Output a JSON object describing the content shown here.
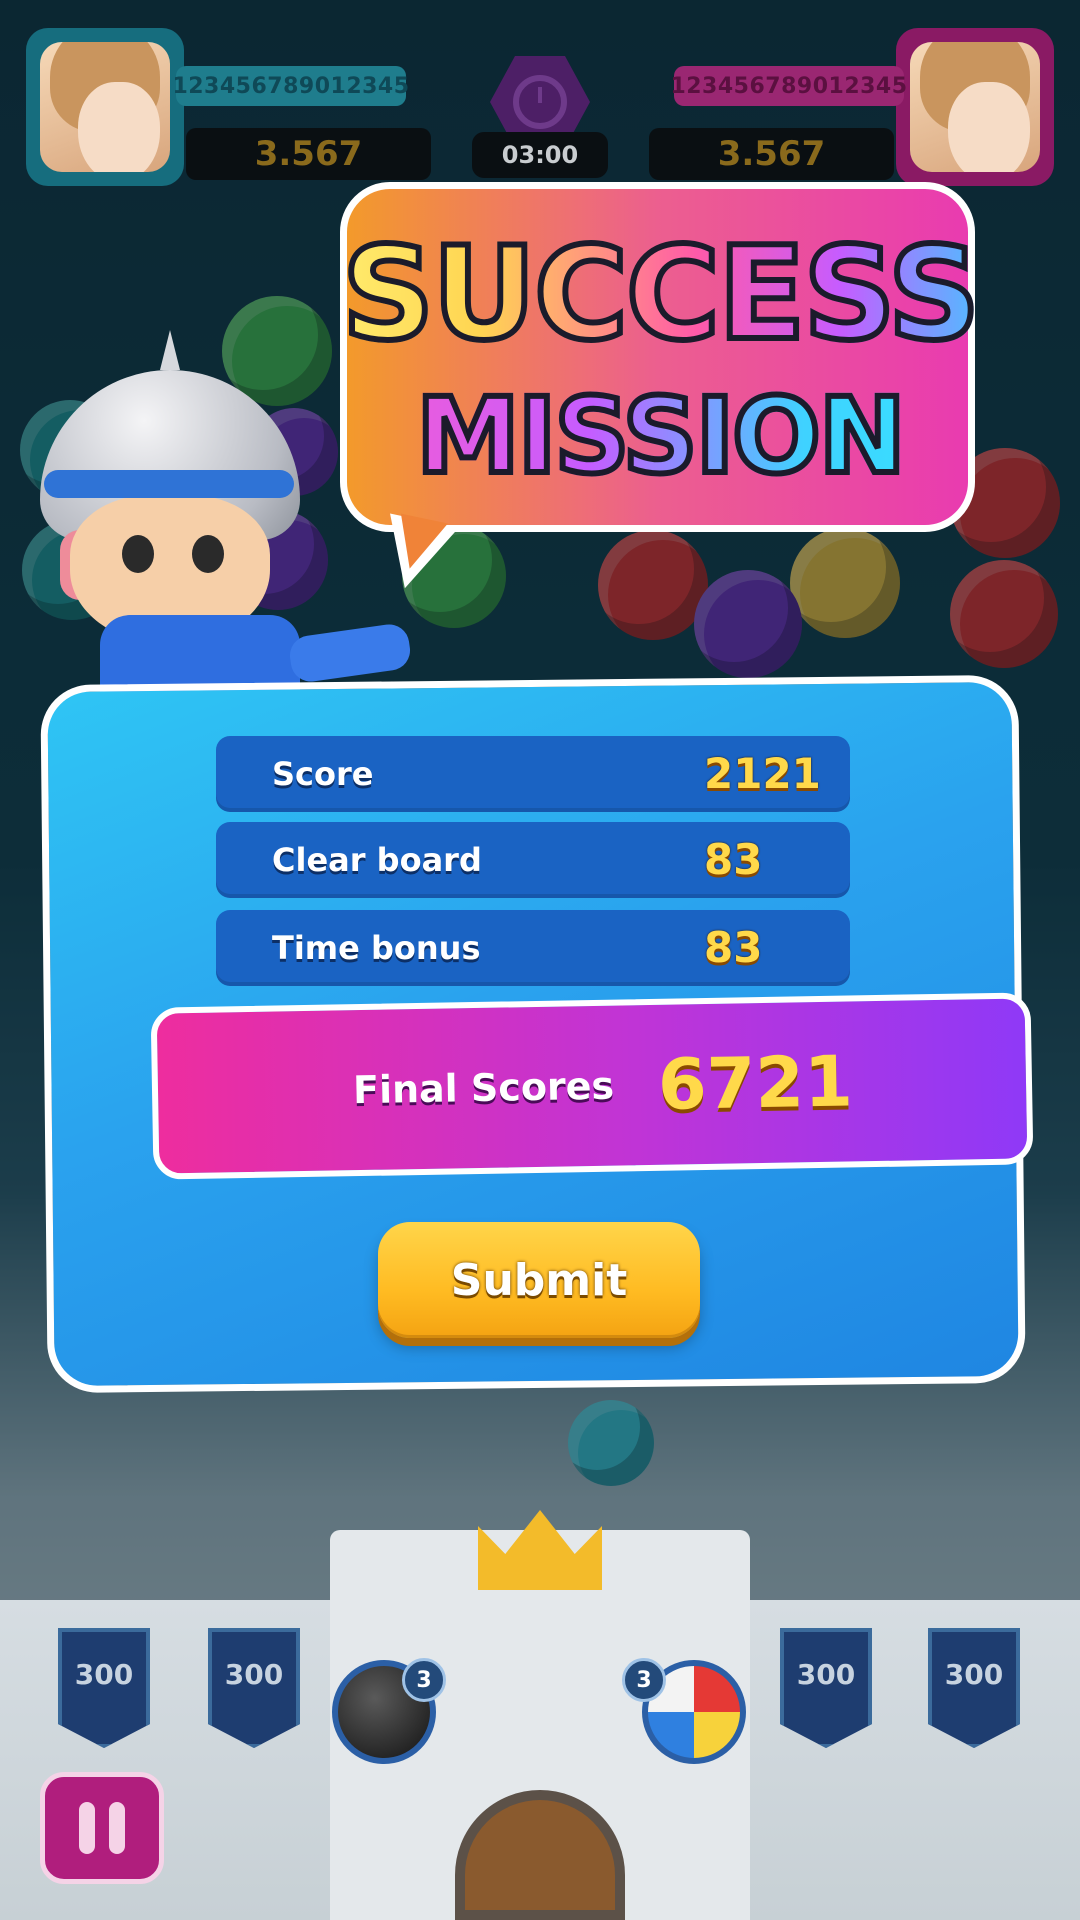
{
  "hud": {
    "player_left": {
      "name": "123456789012345",
      "score": "3.567"
    },
    "player_right": {
      "name": "123456789012345",
      "score": "3.567"
    },
    "timer": "03:00"
  },
  "banner": {
    "line1": "SUCCESS",
    "line2": "MISSION"
  },
  "results": {
    "rows": [
      {
        "label": "Score",
        "value": "2121"
      },
      {
        "label": "Clear board",
        "value": "83"
      },
      {
        "label": "Time bonus",
        "value": "83"
      }
    ],
    "final_label": "Final Scores",
    "final_value": "6721",
    "submit_label": "Submit"
  },
  "bottom": {
    "flags": [
      "300",
      "300",
      "300",
      "300"
    ],
    "powerups": [
      {
        "icon": "bomb-icon",
        "count": "3"
      },
      {
        "icon": "beach-ball-icon",
        "count": "3"
      }
    ]
  },
  "colors": {
    "panel": "#2aa2ee",
    "row": "#1a63c3",
    "final_from": "#ee2d9e",
    "final_to": "#8f39f7",
    "submit": "#ffbb22",
    "value_gold": "#ffd94a"
  }
}
